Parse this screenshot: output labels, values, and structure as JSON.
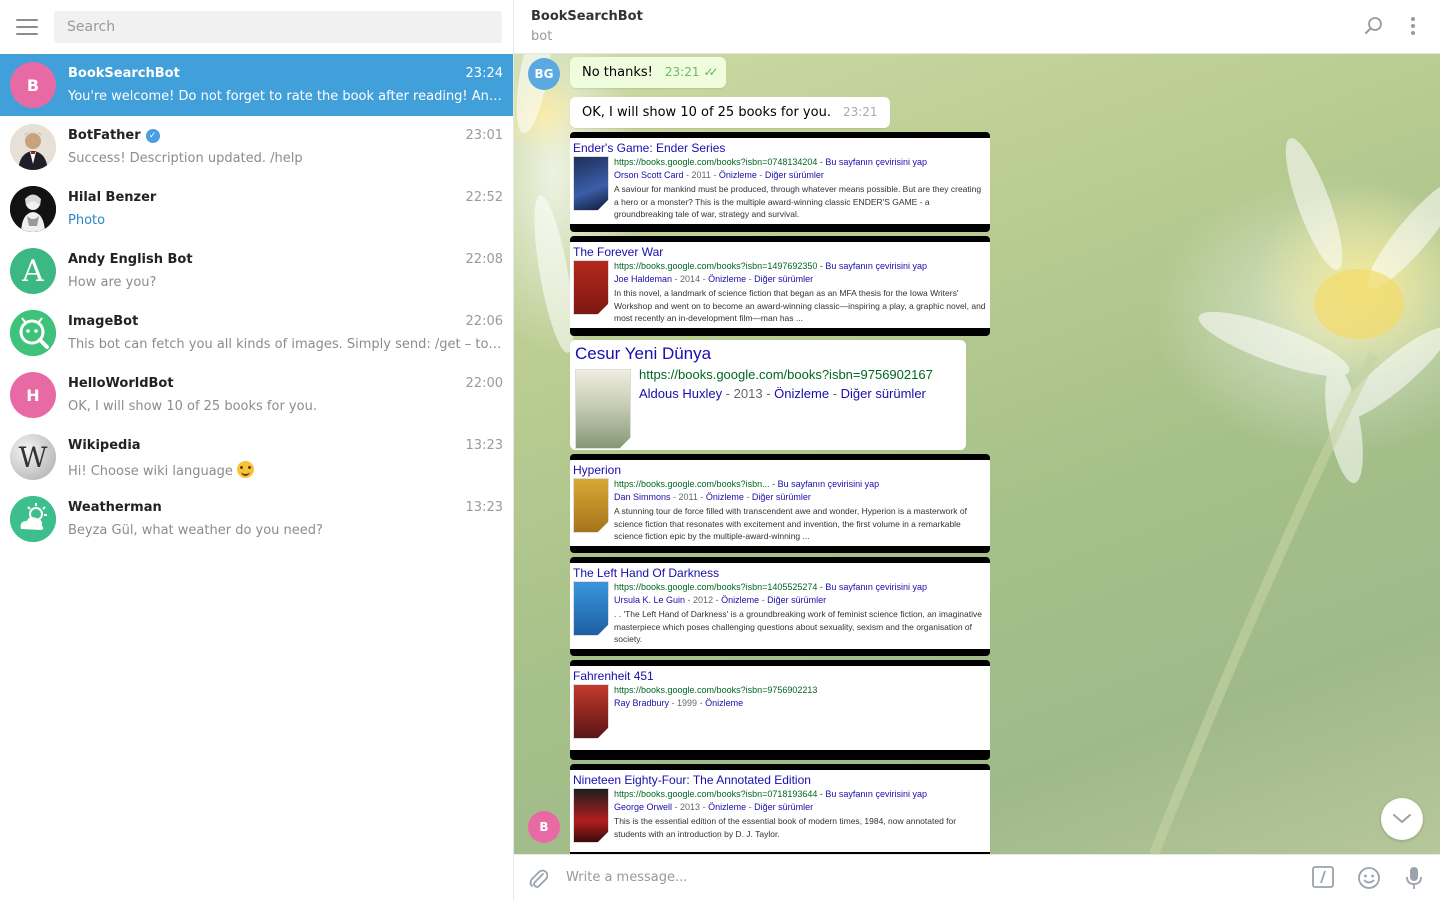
{
  "sidebar": {
    "search_placeholder": "Search",
    "chats": [
      {
        "name": "BookSearchBot",
        "time": "23:24",
        "preview": "You're welcome! Do not forget to rate the book after reading! And you...",
        "avatar_letter": "B",
        "avatar_color": "#e86aa5",
        "active": true
      },
      {
        "name": "BotFather",
        "time": "23:01",
        "preview": "Success! Description updated. /help",
        "verified": true
      },
      {
        "name": "Hilal Benzer",
        "time": "22:52",
        "preview": "Photo"
      },
      {
        "name": "Andy English Bot",
        "time": "22:08",
        "preview": "How are you?",
        "avatar_letter": "A",
        "avatar_color": "#3cb882"
      },
      {
        "name": "ImageBot",
        "time": "22:06",
        "preview": "This bot can fetch you all kinds of images. Simply send: /get – to find a ..."
      },
      {
        "name": "HelloWorldBot",
        "time": "22:00",
        "preview": "OK, I will show 10 of 25 books for you.",
        "avatar_letter": "H",
        "avatar_color": "#e86aa5"
      },
      {
        "name": "Wikipedia",
        "time": "13:23",
        "preview": "Hi! Choose wiki language"
      },
      {
        "name": "Weatherman",
        "time": "13:23",
        "preview": "Beyza Gül, what weather do you need?"
      }
    ]
  },
  "header": {
    "name": "BookSearchBot",
    "status": "bot"
  },
  "messages": {
    "user_avatar": "BG",
    "bot_avatar": "B",
    "out_text": "No thanks!",
    "out_time": "23:21",
    "in_text": "OK, I will show 10 of 25 books for you.",
    "in_time": "23:21"
  },
  "books": [
    {
      "title": "Ender's Game: Ender Series",
      "url": "https://books.google.com/books?isbn=0748134204",
      "translate": "Bu sayfanın çevirisini yap",
      "author": "Orson Scott Card",
      "year": "2011",
      "preview": "Önizleme",
      "other": "Diğer sürümler",
      "desc": "A saviour for mankind must be produced, through whatever means possible. But are they creating a hero or a monster? This is the multiple award-winning classic ENDER'S GAME - a groundbreaking tale of war, strategy and survival.",
      "cover_color": "#1d2f5a"
    },
    {
      "title": "The Forever War",
      "url": "https://books.google.com/books?isbn=1497692350",
      "translate": "Bu sayfanın çevirisini yap",
      "author": "Joe Haldeman",
      "year": "2014",
      "preview": "Önizleme",
      "other": "Diğer sürümler",
      "desc": "In this novel, a landmark of science fiction that began as an MFA thesis for the Iowa Writers' Workshop and went on to become an award-winning classic—inspiring a play, a graphic novel, and most recently an in-development film—man has ...",
      "cover_color": "#b3281f"
    },
    {
      "title": "Cesur Yeni Dünya",
      "url": "https://books.google.com/books?isbn=9756902167",
      "author": "Aldous Huxley",
      "year": "2013",
      "preview": "Önizleme",
      "other": "Diğer sürümler",
      "cover_color": "#a9b79a"
    },
    {
      "title": "Hyperion",
      "url": "https://books.google.com/books?isbn...",
      "translate": "Bu sayfanın çevirisini yap",
      "author": "Dan Simmons",
      "year": "2011",
      "preview": "Önizleme",
      "other": "Diğer sürümler",
      "desc": "A stunning tour de force filled with transcendent awe and wonder, Hyperion is a masterwork of science fiction that resonates with excitement and invention, the first volume in a remarkable science fiction epic by the multiple-award-winning ...",
      "cover_color": "#c9951e"
    },
    {
      "title": "The Left Hand Of Darkness",
      "url": "https://books.google.com/books?isbn=1405525274",
      "translate": "Bu sayfanın çevirisini yap",
      "author": "Ursula K. Le Guin",
      "year": "2012",
      "preview": "Önizleme",
      "other": "Diğer sürümler",
      "desc": ". . 'The Left Hand of Darkness' is a groundbreaking work of feminist science fiction, an imaginative masterpiece which poses challenging questions about sexuality, sexism and the organisation of society.",
      "cover_color": "#2a7dc4"
    },
    {
      "title": "Fahrenheit 451",
      "url": "https://books.google.com/books?isbn=9756902213",
      "author": "Ray Bradbury",
      "year": "1999",
      "preview": "Önizleme",
      "cover_color": "#8a2a2a"
    },
    {
      "title": "Nineteen Eighty-Four: The Annotated Edition",
      "url": "https://books.google.com/books?isbn=0718193644",
      "translate": "Bu sayfanın çevirisini yap",
      "author": "George Orwell",
      "year": "2013",
      "preview": "Önizleme",
      "other": "Diğer sürümler",
      "desc": "This is the essential edition of the essential book of modern times, 1984, now annotated for students with an introduction by D. J. Taylor.",
      "cover_color": "#b21e1e"
    }
  ],
  "composer": {
    "placeholder": "Write a message..."
  },
  "colors": {
    "accent": "#419fd9",
    "link": "#1a0dab",
    "url": "#006621"
  }
}
